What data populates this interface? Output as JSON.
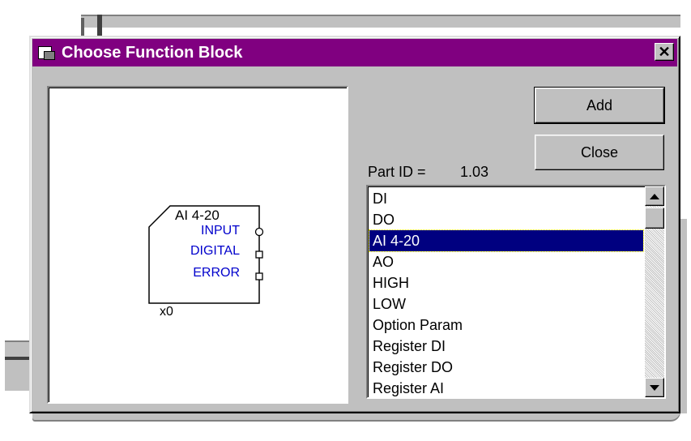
{
  "dialog": {
    "title": "Choose Function Block",
    "close_glyph": "✕",
    "title_icon": "form-window-icon"
  },
  "buttons": {
    "add_label": "Add",
    "close_label": "Close"
  },
  "part_id": {
    "label": "Part ID =",
    "value": "1.03"
  },
  "preview": {
    "block_title": "AI 4-20",
    "ports": [
      "INPUT",
      "DIGITAL",
      "ERROR"
    ],
    "instance_label": "x0",
    "port_color": "#0000cc"
  },
  "list": {
    "items": [
      "DI",
      "DO",
      "AI 4-20",
      "AO",
      "HIGH",
      "LOW",
      "Option Param",
      "Register DI",
      "Register DO",
      "Register AI"
    ],
    "selected": "AI 4-20",
    "selected_color": "#000080"
  },
  "colors": {
    "titlebar": "#800080",
    "face": "#c0c0c0"
  }
}
